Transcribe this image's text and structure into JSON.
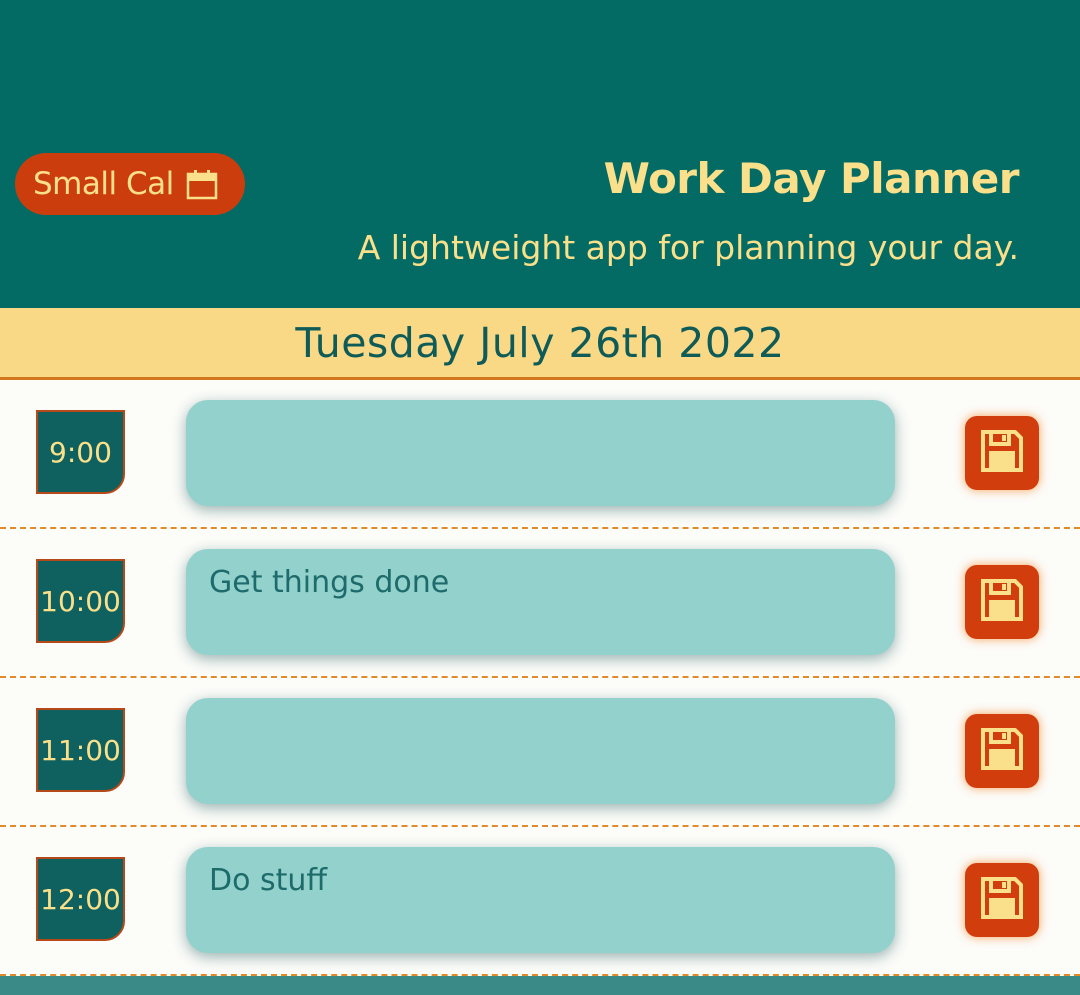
{
  "header": {
    "calendar_button": "Small Cal",
    "title": "Work Day Planner",
    "subtitle": "A lightweight app for planning your day."
  },
  "current_date": "Tuesday July 26th 2022",
  "time_blocks": [
    {
      "hour": "9:00",
      "note": ""
    },
    {
      "hour": "10:00",
      "note": "Get things done"
    },
    {
      "hour": "11:00",
      "note": ""
    },
    {
      "hour": "12:00",
      "note": "Do stuff"
    }
  ],
  "icons": {
    "calendar": "calendar-icon",
    "save": "floppy-disk-save-icon"
  },
  "colors": {
    "header_bg": "#046b64",
    "accent_yellow": "#fae08a",
    "button_red": "#cc3d0e",
    "date_bar": "#f9d985",
    "note_bg": "#93d1cc"
  }
}
